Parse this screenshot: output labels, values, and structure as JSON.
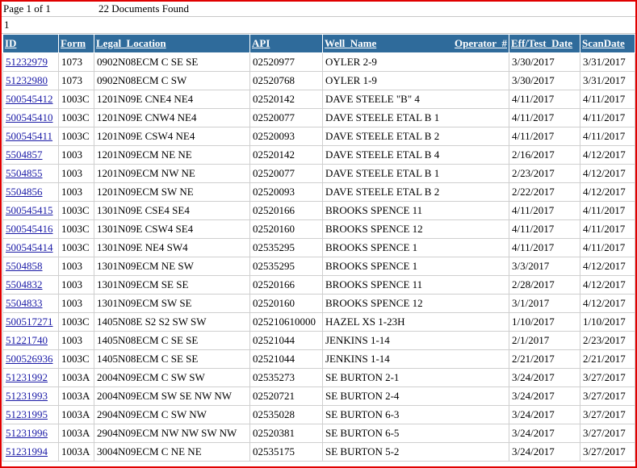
{
  "header": {
    "page_info": "Page 1 of 1",
    "documents_found": "22 Documents Found",
    "page_link": "1"
  },
  "columns": {
    "id": "ID",
    "form": "Form",
    "legal_location": "Legal_Location",
    "api": "API",
    "well_name": "Well_Name",
    "operator": "Operator_#",
    "eff_test_date": "Eff/Test_Date",
    "scan_date": "ScanDate"
  },
  "rows": [
    {
      "id": "51232979",
      "form": "1073",
      "legal": "0902N08ECM C SE SE",
      "api": "02520977",
      "well": "OYLER 2-9",
      "operator": "",
      "eff": "3/30/2017",
      "scan": "3/31/2017"
    },
    {
      "id": "51232980",
      "form": "1073",
      "legal": "0902N08ECM C SW",
      "api": "02520768",
      "well": "OYLER 1-9",
      "operator": "",
      "eff": "3/30/2017",
      "scan": "3/31/2017"
    },
    {
      "id": "500545412",
      "form": "1003C",
      "legal": "1201N09E CNE4 NE4",
      "api": "02520142",
      "well": "DAVE STEELE \"B\" 4",
      "operator": "",
      "eff": "4/11/2017",
      "scan": "4/11/2017"
    },
    {
      "id": "500545410",
      "form": "1003C",
      "legal": "1201N09E CNW4 NE4",
      "api": "02520077",
      "well": "DAVE STEELE ETAL B 1",
      "operator": "",
      "eff": "4/11/2017",
      "scan": "4/11/2017"
    },
    {
      "id": "500545411",
      "form": "1003C",
      "legal": "1201N09E CSW4 NE4",
      "api": "02520093",
      "well": "DAVE STEELE ETAL B 2",
      "operator": "",
      "eff": "4/11/2017",
      "scan": "4/11/2017"
    },
    {
      "id": "5504857",
      "form": "1003",
      "legal": "1201N09ECM NE NE",
      "api": "02520142",
      "well": "DAVE STEELE ETAL B 4",
      "operator": "",
      "eff": "2/16/2017",
      "scan": "4/12/2017"
    },
    {
      "id": "5504855",
      "form": "1003",
      "legal": "1201N09ECM NW NE",
      "api": "02520077",
      "well": "DAVE STEELE ETAL B 1",
      "operator": "",
      "eff": "2/23/2017",
      "scan": "4/12/2017"
    },
    {
      "id": "5504856",
      "form": "1003",
      "legal": "1201N09ECM SW NE",
      "api": "02520093",
      "well": "DAVE STEELE ETAL B 2",
      "operator": "",
      "eff": "2/22/2017",
      "scan": "4/12/2017"
    },
    {
      "id": "500545415",
      "form": "1003C",
      "legal": "1301N09E CSE4 SE4",
      "api": "02520166",
      "well": "BROOKS SPENCE 11",
      "operator": "",
      "eff": "4/11/2017",
      "scan": "4/11/2017"
    },
    {
      "id": "500545416",
      "form": "1003C",
      "legal": "1301N09E CSW4 SE4",
      "api": "02520160",
      "well": "BROOKS SPENCE 12",
      "operator": "",
      "eff": "4/11/2017",
      "scan": "4/11/2017"
    },
    {
      "id": "500545414",
      "form": "1003C",
      "legal": "1301N09E NE4 SW4",
      "api": "02535295",
      "well": "BROOKS SPENCE 1",
      "operator": "",
      "eff": "4/11/2017",
      "scan": "4/11/2017"
    },
    {
      "id": "5504858",
      "form": "1003",
      "legal": "1301N09ECM NE SW",
      "api": "02535295",
      "well": "BROOKS SPENCE 1",
      "operator": "",
      "eff": "3/3/2017",
      "scan": "4/12/2017"
    },
    {
      "id": "5504832",
      "form": "1003",
      "legal": "1301N09ECM SE SE",
      "api": "02520166",
      "well": "BROOKS SPENCE 11",
      "operator": "",
      "eff": "2/28/2017",
      "scan": "4/12/2017"
    },
    {
      "id": "5504833",
      "form": "1003",
      "legal": "1301N09ECM SW SE",
      "api": "02520160",
      "well": "BROOKS SPENCE 12",
      "operator": "",
      "eff": "3/1/2017",
      "scan": "4/12/2017"
    },
    {
      "id": "500517271",
      "form": "1003C",
      "legal": "1405N08E S2 S2 SW SW",
      "api": "025210610000",
      "well": "HAZEL XS 1-23H",
      "operator": "",
      "eff": "1/10/2017",
      "scan": "1/10/2017"
    },
    {
      "id": "51221740",
      "form": "1003",
      "legal": "1405N08ECM C SE SE",
      "api": "02521044",
      "well": "JENKINS 1-14",
      "operator": "",
      "eff": "2/1/2017",
      "scan": "2/23/2017"
    },
    {
      "id": "500526936",
      "form": "1003C",
      "legal": "1405N08ECM C SE SE",
      "api": "02521044",
      "well": "JENKINS 1-14",
      "operator": "",
      "eff": "2/21/2017",
      "scan": "2/21/2017"
    },
    {
      "id": "51231992",
      "form": "1003A",
      "legal": "2004N09ECM C SW SW",
      "api": "02535273",
      "well": "SE BURTON 2-1",
      "operator": "",
      "eff": "3/24/2017",
      "scan": "3/27/2017"
    },
    {
      "id": "51231993",
      "form": "1003A",
      "legal": "2004N09ECM SW SE NW NW",
      "api": "02520721",
      "well": "SE BURTON 2-4",
      "operator": "",
      "eff": "3/24/2017",
      "scan": "3/27/2017"
    },
    {
      "id": "51231995",
      "form": "1003A",
      "legal": "2904N09ECM C SW NW",
      "api": "02535028",
      "well": "SE BURTON 6-3",
      "operator": "",
      "eff": "3/24/2017",
      "scan": "3/27/2017"
    },
    {
      "id": "51231996",
      "form": "1003A",
      "legal": "2904N09ECM NW NW SW NW",
      "api": "02520381",
      "well": "SE BURTON 6-5",
      "operator": "",
      "eff": "3/24/2017",
      "scan": "3/27/2017"
    },
    {
      "id": "51231994",
      "form": "1003A",
      "legal": "3004N09ECM C NE NE",
      "api": "02535175",
      "well": "SE BURTON 5-2",
      "operator": "",
      "eff": "3/24/2017",
      "scan": "3/27/2017"
    }
  ],
  "colors": {
    "header_bg": "#2f6b9b",
    "frame_border": "#e00000",
    "link": "#1a1aa6"
  }
}
